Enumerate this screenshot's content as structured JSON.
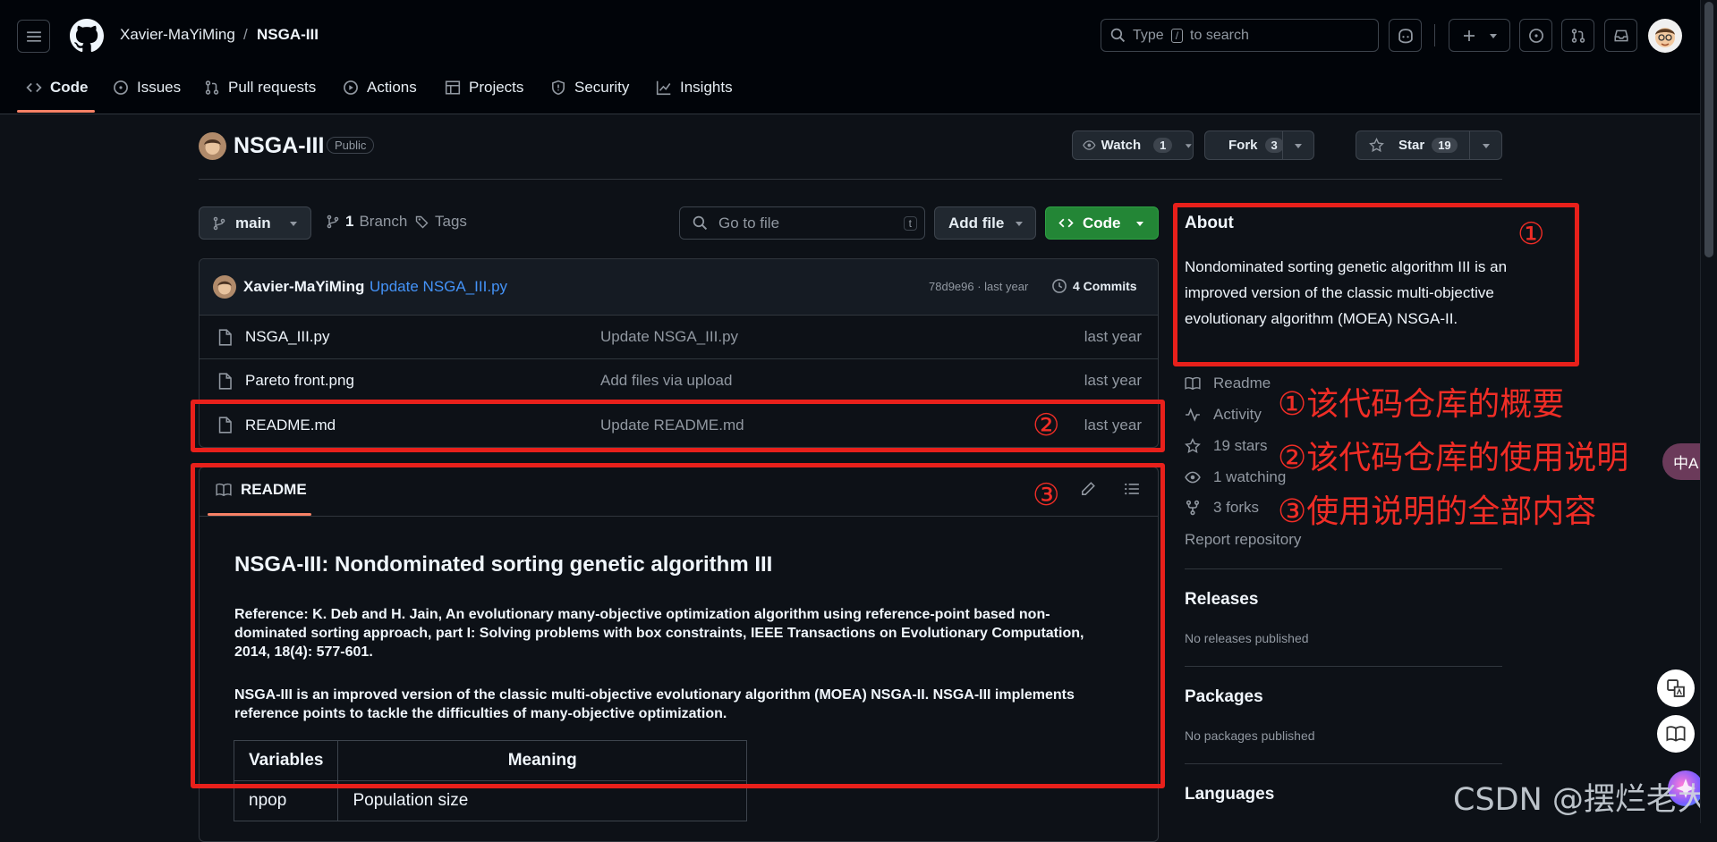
{
  "header": {
    "owner": "Xavier-MaYiMing",
    "separator": "/",
    "repo": "NSGA-III",
    "search_prefix": "Type",
    "search_key": "/",
    "search_suffix": "to search"
  },
  "nav_tabs": [
    {
      "label": "Code",
      "icon": "code-icon"
    },
    {
      "label": "Issues",
      "icon": "issue-icon"
    },
    {
      "label": "Pull requests",
      "icon": "pull-request-icon"
    },
    {
      "label": "Actions",
      "icon": "play-icon"
    },
    {
      "label": "Projects",
      "icon": "table-icon"
    },
    {
      "label": "Security",
      "icon": "shield-icon"
    },
    {
      "label": "Insights",
      "icon": "graph-icon"
    }
  ],
  "repo_header": {
    "name": "NSGA-III",
    "visibility": "Public",
    "watch_label": "Watch",
    "watch_count": "1",
    "fork_label": "Fork",
    "fork_count": "3",
    "star_label": "Star",
    "star_count": "19"
  },
  "toolbar": {
    "branch": "main",
    "branch_count": "1",
    "branch_label": "Branch",
    "tags_label": "Tags",
    "goto_placeholder": "Go to file",
    "goto_key": "t",
    "add_file_label": "Add file",
    "code_label": "Code"
  },
  "commit": {
    "author": "Xavier-MaYiMing",
    "message": "Update NSGA_III.py",
    "meta": "78d9e96 · last year",
    "commits_label": "4 Commits"
  },
  "files": [
    {
      "name": "NSGA_III.py",
      "message": "Update NSGA_III.py",
      "time": "last year"
    },
    {
      "name": "Pareto front.png",
      "message": "Add files via upload",
      "time": "last year"
    },
    {
      "name": "README.md",
      "message": "Update README.md",
      "time": "last year"
    }
  ],
  "readme": {
    "tab_label": "README",
    "heading": "NSGA-III: Nondominated sorting genetic algorithm III",
    "reference": "Reference: K. Deb and H. Jain, An evolutionary many-objective optimization algorithm using reference-point based non-dominated sorting approach, part I: Solving problems with box constraints, IEEE Transactions on Evolutionary Computation, 2014, 18(4): 577-601.",
    "description": "NSGA-III is an improved version of the classic multi-objective evolutionary algorithm (MOEA) NSGA-II. NSGA-III implements reference points to tackle the difficulties of many-objective optimization.",
    "table_headers": [
      "Variables",
      "Meaning"
    ],
    "table_rows": [
      [
        "npop",
        "Population size"
      ]
    ]
  },
  "about": {
    "heading": "About",
    "text": "Nondominated sorting genetic algorithm III is an improved version of the classic multi-objective evolutionary algorithm (MOEA) NSGA-II.",
    "links": [
      {
        "label": "Readme",
        "icon": "book-icon"
      },
      {
        "label": "Activity",
        "icon": "pulse-icon"
      },
      {
        "label": "19 stars",
        "icon": "star-icon"
      },
      {
        "label": "1 watching",
        "icon": "eye-icon"
      },
      {
        "label": "3 forks",
        "icon": "fork-icon"
      }
    ],
    "report": "Report repository"
  },
  "releases": {
    "heading": "Releases",
    "text": "No releases published"
  },
  "packages": {
    "heading": "Packages",
    "text": "No packages published"
  },
  "languages": {
    "heading": "Languages"
  },
  "annotations": {
    "num1": "①",
    "num2": "②",
    "num3": "③",
    "note1": "①该代码仓库的概要",
    "note2": "②该代码仓库的使用说明",
    "note3": "③使用说明的全部内容"
  },
  "floating": {
    "translate_label": "中A"
  },
  "watermark": "CSDN @摆烂老大",
  "colors": {
    "accent_orange": "#f78166",
    "code_button_green": "#238636",
    "link_blue": "#4493f8",
    "annotation_red": "#e8201b"
  }
}
